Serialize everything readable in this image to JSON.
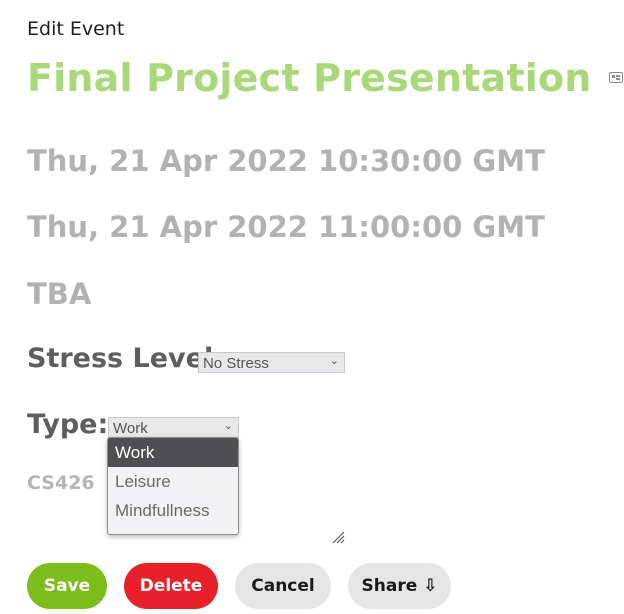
{
  "header": {
    "label": "Edit Event"
  },
  "event": {
    "title": "Final Project Presentation",
    "start": "Thu, 21 Apr 2022 10:30:00 GMT",
    "end": "Thu, 21 Apr 2022 11:00:00 GMT",
    "location": "TBA",
    "course": "CS426"
  },
  "stress": {
    "label": "Stress Level:",
    "value": "No Stress"
  },
  "type": {
    "label": "Type:",
    "value": "Work",
    "options": [
      "Work",
      "Leisure",
      "Mindfullness"
    ]
  },
  "actions": {
    "save": "Save",
    "delete": "Delete",
    "cancel": "Cancel",
    "share": "Share ⇩"
  },
  "colors": {
    "title": "#a8d878",
    "save": "#7cbd1c",
    "delete": "#e8202a",
    "neutral_button": "#e5e5e5",
    "dropdown_selected": "#4e4e54"
  },
  "icons": {
    "card": "card-icon",
    "chevron": "chevron-down-icon",
    "resize": "resize-handle-icon",
    "download": "download-arrow"
  }
}
